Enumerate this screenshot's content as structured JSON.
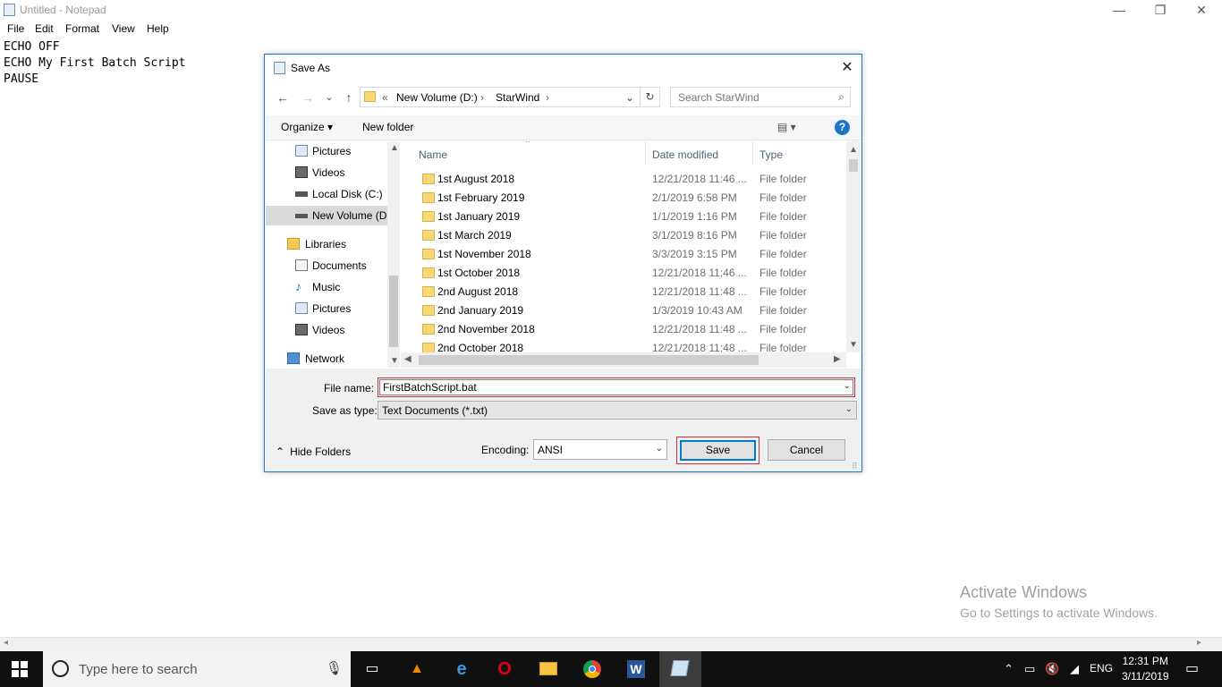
{
  "notepad": {
    "title": "Untitled - Notepad",
    "menu": [
      "File",
      "Edit",
      "Format",
      "View",
      "Help"
    ],
    "lines": [
      "ECHO OFF",
      "ECHO My First Batch Script",
      "PAUSE"
    ],
    "window_controls": {
      "minimize": "—",
      "maximize": "❐",
      "close": "✕"
    }
  },
  "dialog": {
    "title": "Save As",
    "close": "✕",
    "nav": {
      "back": "←",
      "forward": "→",
      "recent": "⌄",
      "up": "↑"
    },
    "address": {
      "overflow": "«",
      "segments": [
        "New Volume (D:)",
        "StarWind"
      ],
      "sep": "›",
      "dropdown": "⌄",
      "refresh": "↻"
    },
    "search_placeholder": "Search StarWind",
    "toolbar": {
      "organize": "Organize ▾",
      "new_folder": "New folder",
      "view": "▤ ▾",
      "help": "?"
    },
    "nav_pane": [
      {
        "label": "Pictures",
        "icon": "pictures-icon"
      },
      {
        "label": "Videos",
        "icon": "videos-icon"
      },
      {
        "label": "Local Disk (C:)",
        "icon": "drive-icon"
      },
      {
        "label": "New Volume (D:)",
        "icon": "drive-icon",
        "selected": true
      },
      {
        "label": "Libraries",
        "icon": "libraries-icon"
      },
      {
        "label": "Documents",
        "icon": "documents-icon"
      },
      {
        "label": "Music",
        "icon": "music-icon"
      },
      {
        "label": "Pictures",
        "icon": "pictures-icon"
      },
      {
        "label": "Videos",
        "icon": "videos-icon"
      },
      {
        "label": "Network",
        "icon": "network-icon"
      }
    ],
    "columns": {
      "name": "Name",
      "date": "Date modified",
      "type": "Type"
    },
    "files": [
      {
        "name": "1st August 2018",
        "date": "12/21/2018 11:46 ...",
        "type": "File folder"
      },
      {
        "name": "1st February 2019",
        "date": "2/1/2019 6:58 PM",
        "type": "File folder"
      },
      {
        "name": "1st January 2019",
        "date": "1/1/2019 1:16 PM",
        "type": "File folder"
      },
      {
        "name": "1st March 2019",
        "date": "3/1/2019 8:16 PM",
        "type": "File folder"
      },
      {
        "name": "1st November 2018",
        "date": "3/3/2019 3:15 PM",
        "type": "File folder"
      },
      {
        "name": "1st October 2018",
        "date": "12/21/2018 11:46 ...",
        "type": "File folder"
      },
      {
        "name": "2nd August 2018",
        "date": "12/21/2018 11:48 ...",
        "type": "File folder"
      },
      {
        "name": "2nd January 2019",
        "date": "1/3/2019 10:43 AM",
        "type": "File folder"
      },
      {
        "name": "2nd November 2018",
        "date": "12/21/2018 11:48 ...",
        "type": "File folder"
      },
      {
        "name": "2nd October 2018",
        "date": "12/21/2018 11:48 ...",
        "type": "File folder"
      }
    ],
    "file_name_label": "File name:",
    "file_name_value": "FirstBatchScript.bat",
    "save_as_type_label": "Save as type:",
    "save_as_type_value": "Text Documents (*.txt)",
    "hide_folders": "Hide Folders",
    "encoding_label": "Encoding:",
    "encoding_value": "ANSI",
    "save": "Save",
    "cancel": "Cancel"
  },
  "watermark": {
    "line1": "Activate Windows",
    "line2": "Go to Settings to activate Windows."
  },
  "taskbar": {
    "search_placeholder": "Type here to search",
    "language": "ENG",
    "time": "12:31 PM",
    "date": "3/11/2019"
  }
}
